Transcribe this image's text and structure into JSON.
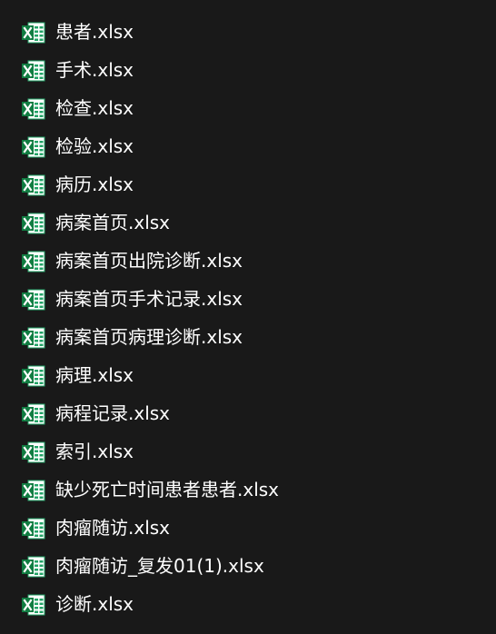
{
  "icon": "excel-file-icon",
  "colors": {
    "background": "#191919",
    "text": "#ffffff",
    "excel_green": "#1E7145",
    "excel_green_dark": "#185C37",
    "sheet_bg": "#FFFFFF"
  },
  "files": [
    {
      "name": "患者.xlsx"
    },
    {
      "name": "手术.xlsx"
    },
    {
      "name": "检查.xlsx"
    },
    {
      "name": "检验.xlsx"
    },
    {
      "name": "病历.xlsx"
    },
    {
      "name": "病案首页.xlsx"
    },
    {
      "name": "病案首页出院诊断.xlsx"
    },
    {
      "name": "病案首页手术记录.xlsx"
    },
    {
      "name": "病案首页病理诊断.xlsx"
    },
    {
      "name": "病理.xlsx"
    },
    {
      "name": "病程记录.xlsx"
    },
    {
      "name": "索引.xlsx"
    },
    {
      "name": "缺少死亡时间患者患者.xlsx"
    },
    {
      "name": "肉瘤随访.xlsx"
    },
    {
      "name": "肉瘤随访_复发01(1).xlsx"
    },
    {
      "name": "诊断.xlsx"
    }
  ]
}
